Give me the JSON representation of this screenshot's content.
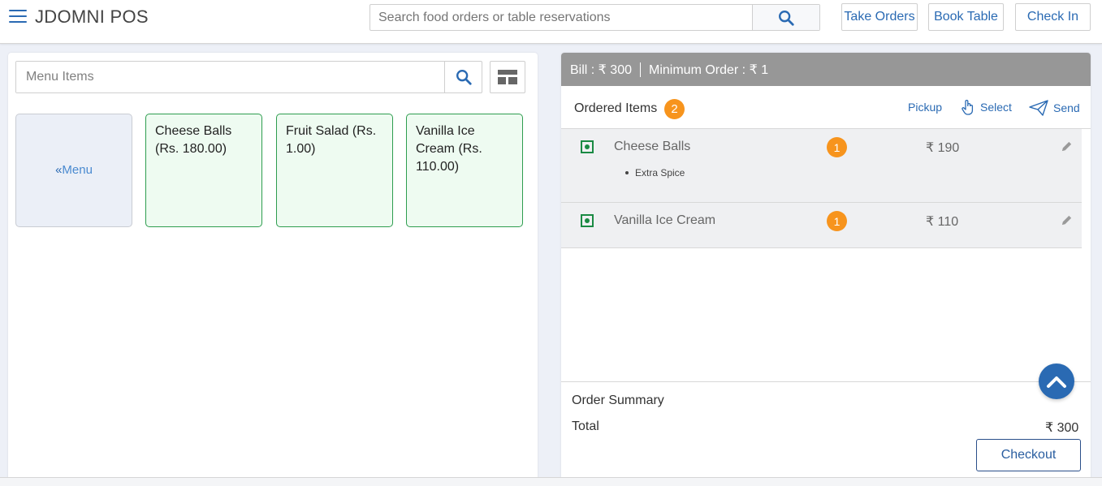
{
  "header": {
    "title": "JDOMNI POS",
    "search_placeholder": "Search food orders or table reservations",
    "buttons": {
      "take_orders": "Take Orders",
      "book_table": "Book Table",
      "check_in": "Check In"
    }
  },
  "menu": {
    "search_placeholder": "Menu Items",
    "back_prefix": "«",
    "back_label": "Menu",
    "items": [
      {
        "label": "Cheese Balls (Rs. 180.00)"
      },
      {
        "label": "Fruit Salad (Rs. 1.00)"
      },
      {
        "label": "Vanilla Ice Cream (Rs. 110.00)"
      }
    ]
  },
  "bill": {
    "bill_text": "Bill : ₹ 300",
    "min_order_text": "Minimum Order : ₹ 1"
  },
  "ordered": {
    "title": "Ordered Items",
    "count": "2",
    "actions": {
      "pickup": "Pickup",
      "select": "Select",
      "send": "Send"
    },
    "rows": [
      {
        "name": "Cheese Balls",
        "qty": "1",
        "price": "₹ 190",
        "addon": "Extra Spice"
      },
      {
        "name": "Vanilla Ice Cream",
        "qty": "1",
        "price": "₹ 110"
      }
    ]
  },
  "summary": {
    "title": "Order Summary",
    "total_label": "Total",
    "total_value": "₹  300",
    "checkout_label": "Checkout"
  },
  "colors": {
    "accent": "#2a6ab3",
    "badge": "#f7941d",
    "veg": "#1a8a43",
    "bill_bar": "#979797"
  }
}
